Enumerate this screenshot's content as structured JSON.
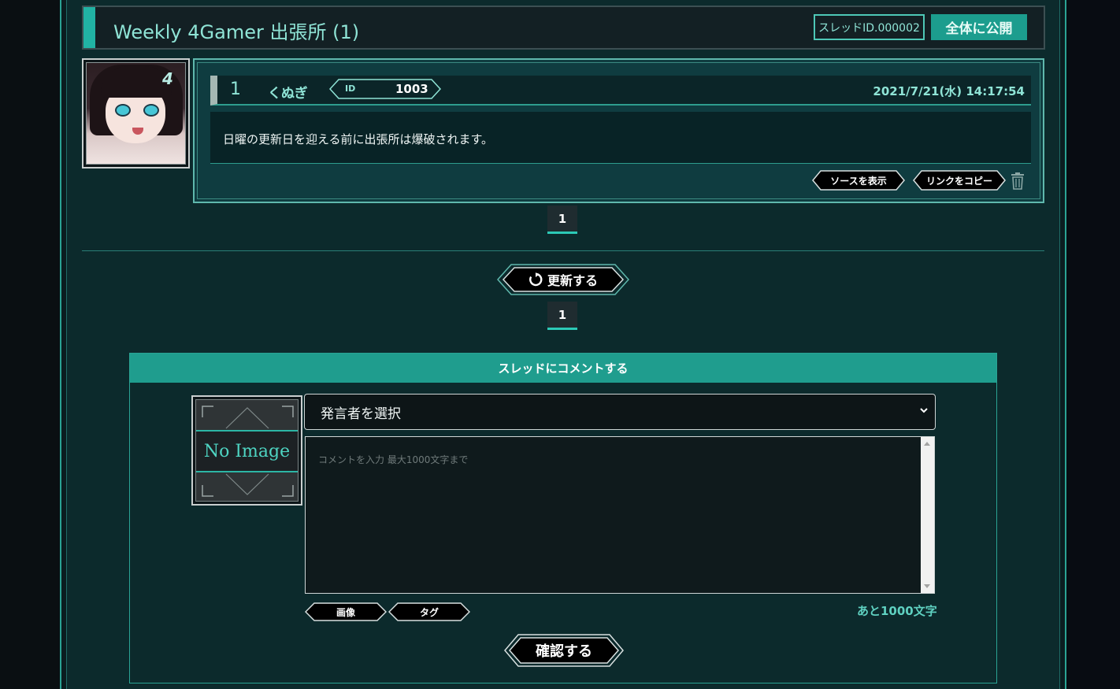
{
  "thread": {
    "title": "Weekly 4Gamer 出張所 (1)",
    "thread_id": "スレッドID.000002",
    "publish_label": "全体に公開"
  },
  "post": {
    "number": "1",
    "author": "くぬぎ",
    "id_label": "ID",
    "id_value": "1003",
    "date": "2021/7/21(水) 14:17:54",
    "body": "日曜の更新日を迎える前に出張所は爆破されます。",
    "show_source_label": "ソースを表示",
    "copy_link_label": "リンクをコピー"
  },
  "pagination": {
    "top_page": "1",
    "bottom_page": "1"
  },
  "refresh_label": "更新する",
  "comment_form": {
    "header": "スレッドにコメントする",
    "no_image_text": "No Image",
    "speaker_select_value": "発言者を選択",
    "comment_placeholder": "コメントを入力 最大1000文字まで",
    "image_button": "画像",
    "tag_button": "タグ",
    "remaining": "あと1000文字",
    "confirm_label": "確認する"
  },
  "colors": {
    "accent": "#21b3a4",
    "text_teal": "#8fe4d6",
    "panel": "#0c2a2c",
    "header_bar": "#1f9d8e"
  }
}
